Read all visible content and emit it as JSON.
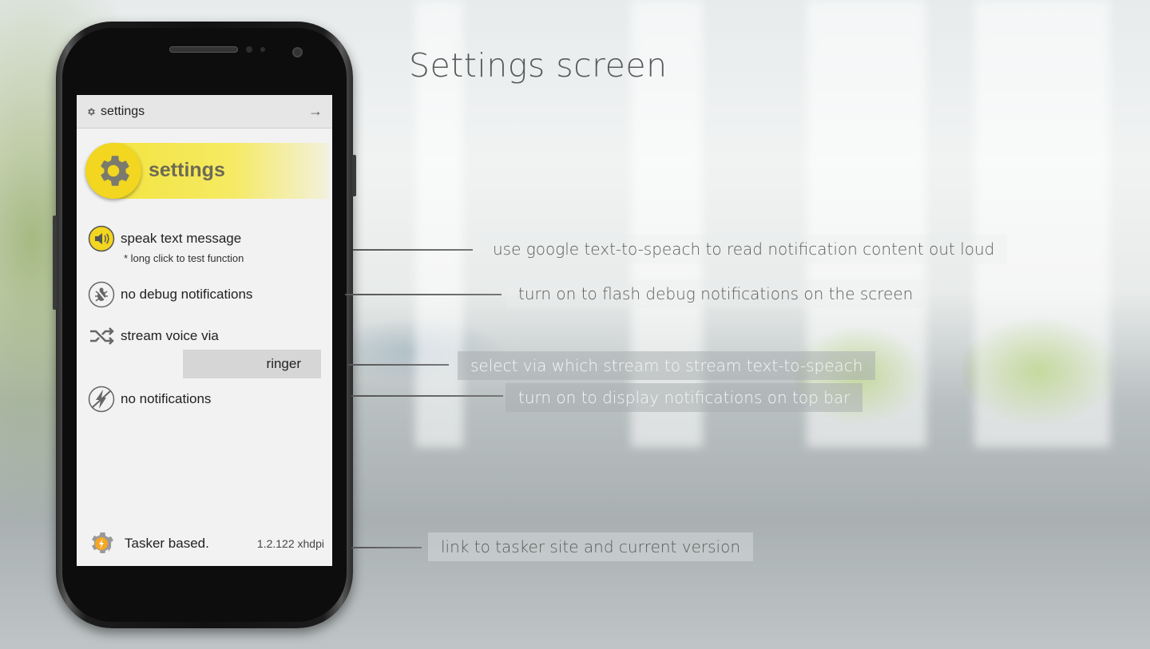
{
  "page": {
    "title": "Settings screen"
  },
  "phone": {
    "topbar": {
      "title": "settings",
      "nav_arrow": "→",
      "icon": "gear-icon"
    },
    "banner": {
      "title": "settings",
      "icon": "gear-icon"
    },
    "items": [
      {
        "label": "speak text message",
        "sublabel": "* long click to test function",
        "icon": "speaker-icon"
      },
      {
        "label": "no debug notifications",
        "icon": "debug-bug-icon"
      },
      {
        "label": "stream voice via",
        "icon": "shuffle-icon",
        "value": "ringer"
      },
      {
        "label": "no notifications",
        "icon": "notifications-off-icon"
      }
    ],
    "footer": {
      "label": "Tasker based.",
      "version": "1.2.122 xhdpi",
      "icon": "tasker-icon"
    }
  },
  "annotations": [
    "use google text-to-speach to read notification content out loud",
    "turn on to flash debug notifications on the screen",
    "select via which stream to stream text-to-speach",
    "turn on to display notifications on top bar",
    "link to tasker site and current version"
  ],
  "colors": {
    "banner_yellow": "#f3e23a",
    "gear_yellow": "#f2d61f",
    "screen_bg": "#f2f2f2"
  }
}
